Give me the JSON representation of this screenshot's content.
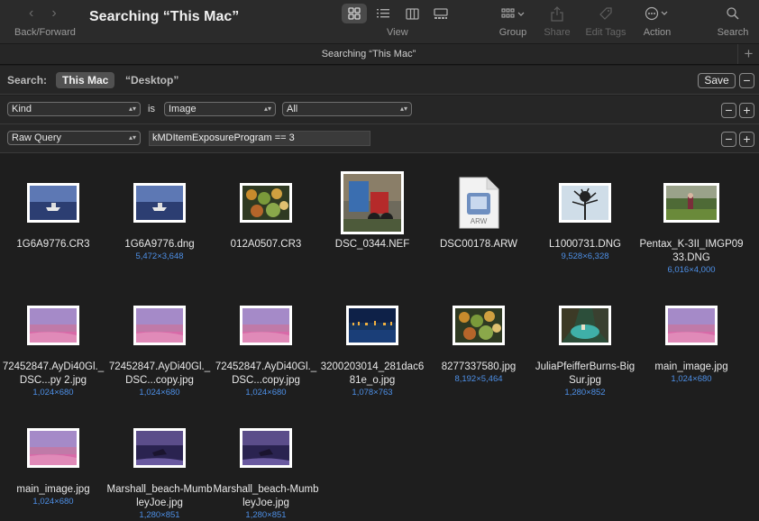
{
  "toolbar": {
    "title": "Searching “This Mac”",
    "nav_label": "Back/Forward",
    "view_label": "View",
    "group_label": "Group",
    "share_label": "Share",
    "edit_tags_label": "Edit Tags",
    "action_label": "Action",
    "search_label": "Search"
  },
  "tabbar": {
    "title": "Searching “This Mac”",
    "add": "+"
  },
  "scope": {
    "label": "Search:",
    "active": "This Mac",
    "other": "“Desktop”",
    "save": "Save"
  },
  "criteria": [
    {
      "attribute": "Kind",
      "operator": "is",
      "value": "Image",
      "sub": "All"
    },
    {
      "attribute": "Raw Query",
      "query": "kMDItemExposureProgram == 3"
    }
  ],
  "files": [
    {
      "name": "1G6A9776.CR3",
      "dims": "",
      "thumb": "boat"
    },
    {
      "name": "1G6A9776.dng",
      "dims": "5,472×3,648",
      "thumb": "boat"
    },
    {
      "name": "012A0507.CR3",
      "dims": "",
      "thumb": "leaves"
    },
    {
      "name": "DSC_0344.NEF",
      "dims": "",
      "thumb": "scooter"
    },
    {
      "name": "DSC00178.ARW",
      "dims": "",
      "thumb": "arw-doc",
      "doc_label": "ARW"
    },
    {
      "name": "L1000731.DNG",
      "dims": "9,528×6,328",
      "thumb": "tree"
    },
    {
      "name": "Pentax_K-3II_IMGP0933.DNG",
      "dims": "6,016×4,000",
      "thumb": "field"
    },
    {
      "name": "72452847.AyDi40Gl._DSC...py 2.jpg",
      "dims": "1,024×680",
      "thumb": "pink-beach"
    },
    {
      "name": "72452847.AyDi40Gl._DSC...copy.jpg",
      "dims": "1,024×680",
      "thumb": "pink-beach"
    },
    {
      "name": "72452847.AyDi40Gl._DSC...copy.jpg",
      "dims": "1,024×680",
      "thumb": "pink-beach"
    },
    {
      "name": "3200203014_281dac681e_o.jpg",
      "dims": "1,078×763",
      "thumb": "night-city"
    },
    {
      "name": "8277337580.jpg",
      "dims": "8,192×5,464",
      "thumb": "leaves"
    },
    {
      "name": "JuliaPfeifferBurns-BigSur.jpg",
      "dims": "1,280×852",
      "thumb": "bigsur"
    },
    {
      "name": "main_image.jpg",
      "dims": "1,024×680",
      "thumb": "pink-beach"
    },
    {
      "name": "main_image.jpg",
      "dims": "1,024×680",
      "thumb": "pink-beach"
    },
    {
      "name": "Marshall_beach-MumbleyJoe.jpg",
      "dims": "1,280×851",
      "thumb": "purple-beach"
    },
    {
      "name": "Marshall_beach-MumbleyJoe.jpg",
      "dims": "1,280×851",
      "thumb": "purple-beach"
    }
  ]
}
